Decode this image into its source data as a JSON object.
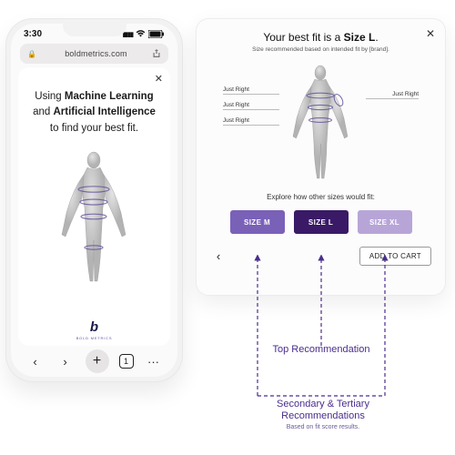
{
  "phone": {
    "time": "3:30",
    "url": "boldmetrics.com",
    "headline_pre": "Using ",
    "headline_b1": "Machine Learning",
    "headline_mid": " and ",
    "headline_b2": "Artificial Intelligence",
    "headline_post": " to find your best fit.",
    "logo_word": "BOLD METRICS",
    "tabs_count": "1"
  },
  "modal": {
    "title_pre": "Your best fit is a ",
    "title_bold": "Size L",
    "title_post": ".",
    "subtitle": "Size recommended based on intended fit by [brand].",
    "fit_labels": {
      "shoulder_left": "Just Right",
      "chest_left": "Just Right",
      "waist_left": "Just Right",
      "arm_right": "Just Right"
    },
    "explore": "Explore how other sizes would fit:",
    "sizes": {
      "m": "SIZE M",
      "l": "SIZE L",
      "xl": "SIZE XL"
    },
    "add_to_cart": "ADD TO CART"
  },
  "annotations": {
    "top": "Top Recommendation",
    "secondary": "Secondary & Tertiary Recommendations",
    "secondary_sub": "Based on fit score results."
  },
  "colors": {
    "accent": "#3a1a66",
    "secondary": "#7a61b8",
    "tertiary": "#b8a5d8"
  }
}
